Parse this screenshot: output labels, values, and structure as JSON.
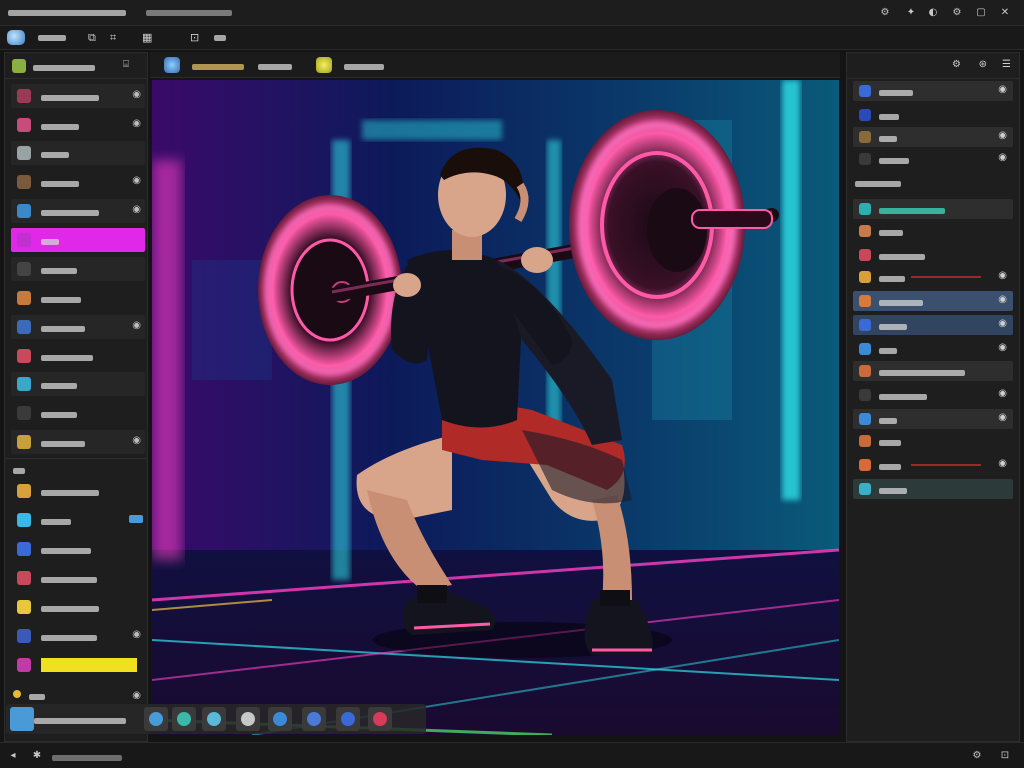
{
  "window": {
    "title": "",
    "subtitle": "",
    "controls": [
      "settings-icon",
      "pin-icon",
      "minimize-icon",
      "maximize-icon",
      "close-icon"
    ]
  },
  "menu": {
    "items": [
      {
        "label": "",
        "icon": "app-logo"
      },
      {
        "label": ""
      },
      {
        "label": ""
      },
      {
        "label": ""
      }
    ],
    "glyphs": [
      "⧉",
      "⌗",
      "▦",
      "⊡"
    ]
  },
  "tool_options": {
    "tool_name": "",
    "preset": "",
    "mode": ""
  },
  "left_panel": {
    "header": "",
    "items": [
      {
        "label": "",
        "color": "#9a3a55"
      },
      {
        "label": "",
        "color": "#c94b7a"
      },
      {
        "label": "",
        "color": "#9aa3a3"
      },
      {
        "label": "",
        "color": "#7a5a3a"
      },
      {
        "label": "",
        "color": "#3a88c8"
      },
      {
        "label": "",
        "color": "#c030d0",
        "active": true
      },
      {
        "label": "",
        "color": "#444444"
      },
      {
        "label": "",
        "color": "#c87a3a"
      },
      {
        "label": "",
        "color": "#3a6ab8"
      },
      {
        "label": "",
        "color": "#c84a5a"
      },
      {
        "label": "",
        "color": "#3aa8c8"
      },
      {
        "label": "",
        "color": "#3a3a3a"
      },
      {
        "label": "",
        "color": "#c8a03a"
      }
    ],
    "section_2_header": "",
    "section_2_items": [
      {
        "label": "",
        "color": "#d8a03a"
      },
      {
        "label": "",
        "color": "#3ab8e8"
      },
      {
        "label": "",
        "color": "#3a6ad8"
      },
      {
        "label": "",
        "color": "#c84a5a"
      },
      {
        "label": "",
        "color": "#e8c83a"
      },
      {
        "label": "",
        "color": "#3a5ab8"
      },
      {
        "label": "",
        "color": "#c03aa8",
        "highlight": "#f0e020"
      }
    ],
    "footer_count": ""
  },
  "right_panel": {
    "header_icons": [
      "adjust-icon",
      "link-icon",
      "menu-icon"
    ],
    "top_items": [
      {
        "label": "",
        "color": "#3a6ad8"
      },
      {
        "label": "",
        "color": "#2a4ab8"
      },
      {
        "label": "",
        "color": "#8a6a3a"
      },
      {
        "label": "",
        "color": "#3a3a3a"
      }
    ],
    "section_label": "",
    "layers": [
      {
        "label": "",
        "color": "#2ab0b0",
        "style": "alt"
      },
      {
        "label": "",
        "color": "#c87a4a"
      },
      {
        "label": "",
        "color": "#c84a5a"
      },
      {
        "label": "",
        "color": "#d8a03a",
        "bar": "#9a2a2a"
      },
      {
        "label": "",
        "color": "#d87a3a",
        "style": "sel"
      },
      {
        "label": "",
        "color": "#3a6ad8",
        "style": "sel2"
      },
      {
        "label": "",
        "color": "#3a8ad8"
      },
      {
        "label": "",
        "color": "#c86a3a",
        "style": "alt"
      },
      {
        "label": "",
        "color": "#3a3a3a"
      },
      {
        "label": "",
        "color": "#3a8ad8",
        "style": "alt"
      },
      {
        "label": "",
        "color": "#c86a3a"
      },
      {
        "label": "",
        "color": "#d86a3a",
        "bar": "#9a2a2a"
      },
      {
        "label": "",
        "color": "#3ab0c8",
        "style": "teal"
      }
    ]
  },
  "filmstrip": {
    "label": "",
    "thumb_colors": [
      "#4a9ad8",
      "#3ab8a8",
      "#5ab8d8",
      "#c8c8c8",
      "#3a8ad8",
      "#4a7ad8",
      "#3a6ad8",
      "#d83a5a"
    ]
  },
  "status_bar": {
    "label": ""
  },
  "accent": {
    "magenta": "#e028e8",
    "cyan": "#2ee0e8",
    "selection": "#3b4f6e",
    "yellow": "#f0e020"
  }
}
